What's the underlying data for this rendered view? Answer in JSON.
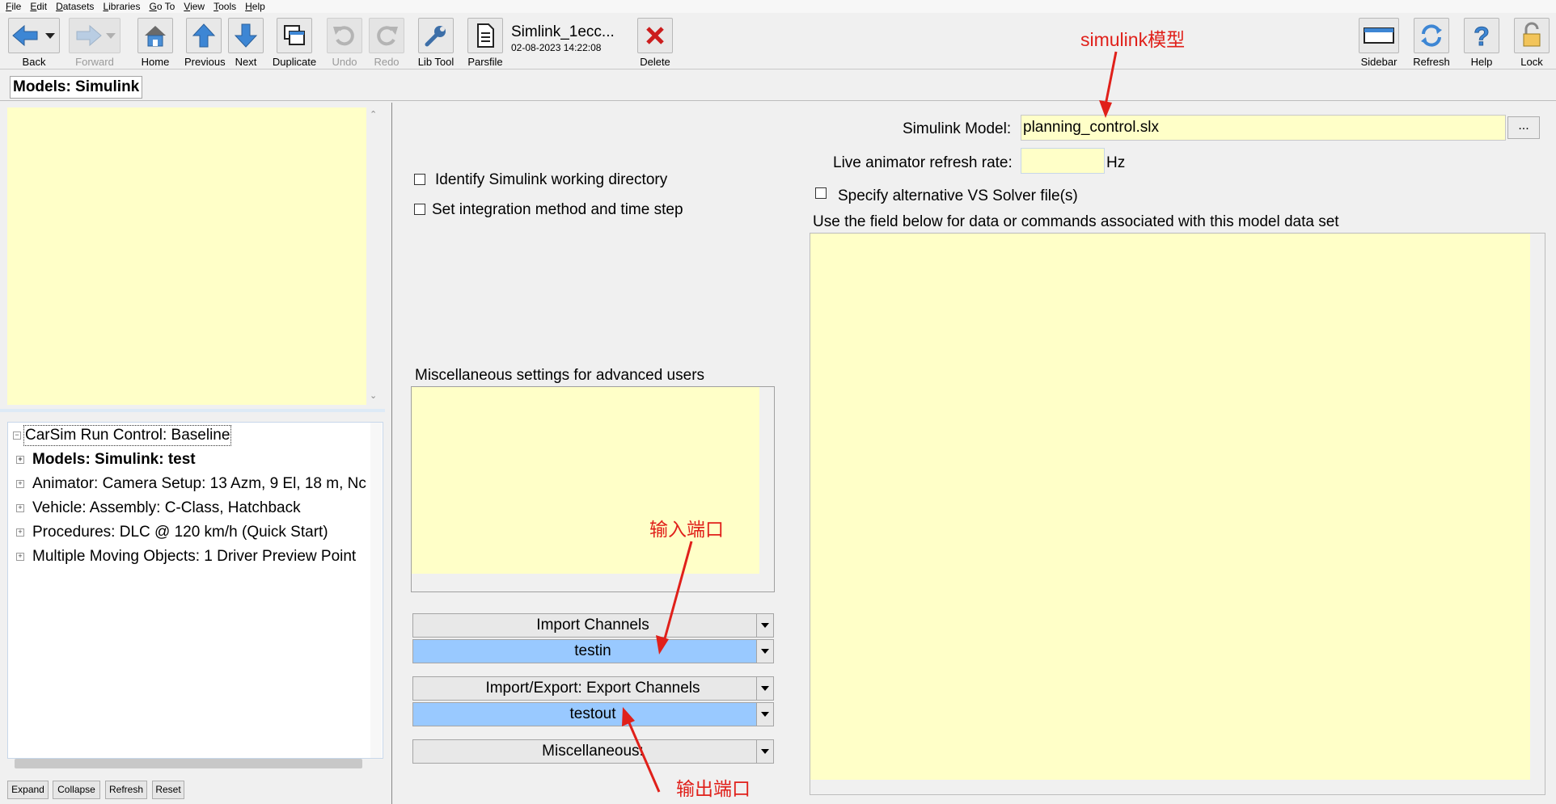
{
  "menu": [
    "File",
    "Edit",
    "Datasets",
    "Libraries",
    "Go To",
    "View",
    "Tools",
    "Help"
  ],
  "toolbar": {
    "back": "Back",
    "forward": "Forward",
    "home": "Home",
    "previous": "Previous",
    "next": "Next",
    "duplicate": "Duplicate",
    "undo": "Undo",
    "redo": "Redo",
    "lib_tool": "Lib Tool",
    "parsfile": "Parsfile",
    "dataset_title": "Simlink_1ecc...",
    "dataset_date": "02-08-2023 14:22:08",
    "delete": "Delete",
    "sidebar": "Sidebar",
    "refresh": "Refresh",
    "help": "Help",
    "lock": "Lock"
  },
  "tab": {
    "label": "Models: Simulink"
  },
  "tree": {
    "root": "CarSim Run Control: Baseline",
    "items": [
      "Models: Simulink: test",
      "Animator: Camera Setup: 13 Azm, 9 El, 18 m, Nc",
      "Vehicle: Assembly: C-Class, Hatchback",
      "Procedures: DLC @ 120 km/h (Quick Start)",
      "Multiple Moving Objects: 1 Driver Preview Point"
    ]
  },
  "sidebar_buttons": {
    "expand": "Expand",
    "collapse": "Collapse",
    "refresh": "Refresh",
    "reset": "Reset"
  },
  "main": {
    "identify_label": "Identify Simulink working directory",
    "integration_label": "Set integration method and time step",
    "misc_settings_label": "Miscellaneous settings for advanced users",
    "import_channels_label": "Import Channels",
    "import_channels_value": "testin",
    "export_channels_label": "Import/Export: Export Channels",
    "export_channels_value": "testout",
    "misc_dropdown_label": "Miscellaneous:",
    "simulink_model_label": "Simulink Model:",
    "simulink_model_value": "planning_control.slx",
    "browse_label": "...",
    "live_refresh_label": "Live animator refresh rate:",
    "hz_label": "Hz",
    "alt_solver_label": "Specify alternative VS Solver file(s)",
    "commands_label": "Use the field below  for data or commands associated with this model data set"
  },
  "annotations": {
    "model": "simulink模型",
    "input_port": "输入端口",
    "output_port": "输出端口"
  },
  "colors": {
    "field_yellow": "#ffffc8",
    "selected_blue": "#99c9ff",
    "annotation_red": "#e0201a"
  }
}
